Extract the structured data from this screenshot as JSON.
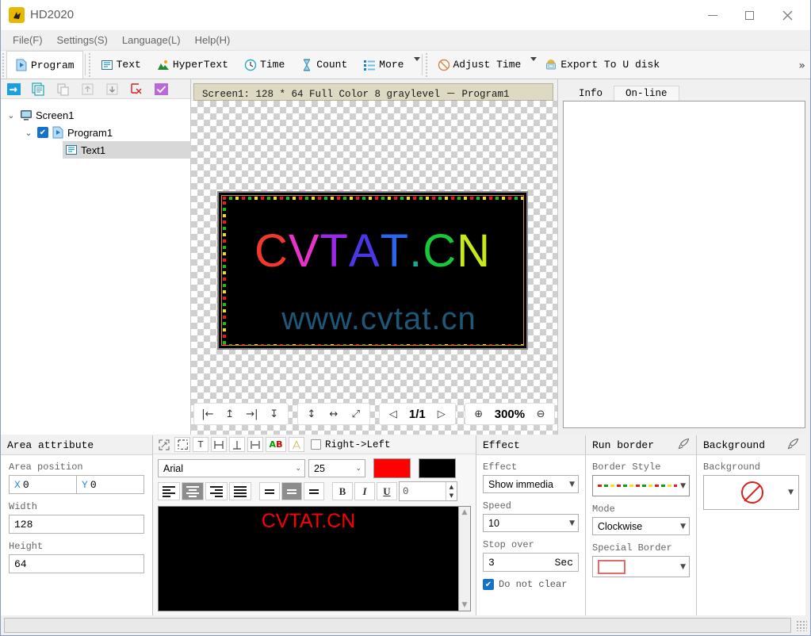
{
  "window": {
    "title": "HD2020",
    "logo_icon": "hd-logo-icon",
    "minimize": "—",
    "maximize": "□",
    "close": "✕"
  },
  "menubar": {
    "items": [
      {
        "label": "File(F)"
      },
      {
        "label": "Settings(S)"
      },
      {
        "label": "Language(L)"
      },
      {
        "label": "Help(H)"
      }
    ]
  },
  "ribbon": {
    "groups": [
      {
        "items": [
          {
            "label": "Program",
            "icon": "program-icon",
            "selected": true
          }
        ]
      },
      {
        "items": [
          {
            "label": "Text",
            "icon": "text-icon"
          },
          {
            "label": "HyperText",
            "icon": "hypertext-icon"
          },
          {
            "label": "Time",
            "icon": "clock-icon"
          },
          {
            "label": "Count",
            "icon": "hourglass-icon"
          },
          {
            "label": "More",
            "icon": "more-list-icon",
            "has_caret": true
          }
        ]
      },
      {
        "items": [
          {
            "label": "Adjust Time",
            "icon": "adjust-time-icon",
            "has_caret": true
          },
          {
            "label": "Export To U disk",
            "icon": "usb-export-icon"
          }
        ]
      }
    ],
    "overflow": "»"
  },
  "tree_panel": {
    "toolbar_icons": [
      "send-icon",
      "copy-program-icon",
      "paste-icon",
      "move-up-icon",
      "move-down-icon",
      "delete-icon",
      "confirm-icon"
    ],
    "nodes": [
      {
        "label": "Screen1",
        "icon": "monitor-icon",
        "twisty": "⌄",
        "indent": 0,
        "checked": false,
        "selected": false
      },
      {
        "label": "Program1",
        "icon": "program-play-icon",
        "twisty": "⌄",
        "indent": 1,
        "checked": true,
        "selected": false
      },
      {
        "label": "Text1",
        "icon": "text-area-icon",
        "twisty": "",
        "indent": 2,
        "checked": false,
        "selected": true
      }
    ]
  },
  "preview": {
    "screen_title": "Screen1: 128 * 64 Full Color 8 graylevel － Program1",
    "led": {
      "text": "CVTAT.CN",
      "letters": [
        {
          "ch": "C",
          "color": "#f0392b"
        },
        {
          "ch": "V",
          "color": "#e832c8"
        },
        {
          "ch": "T",
          "color": "#9a2ae8"
        },
        {
          "ch": "A",
          "color": "#4a38e8"
        },
        {
          "ch": "T",
          "color": "#2a66f0"
        },
        {
          "ch": ".",
          "color": "#18a89a"
        },
        {
          "ch": "C",
          "color": "#18c838"
        },
        {
          "ch": "N",
          "color": "#c8e818"
        }
      ],
      "watermark": "www.cvtat.cn",
      "watermark_color": "#1d5878",
      "border_colors": [
        "#e02020",
        "#16c016",
        "#f0e020"
      ]
    },
    "toolbar": {
      "align_left": "|←",
      "align_top": "↥",
      "align_right": "→|",
      "align_bottom": "↧",
      "stretch_vertical": "↕",
      "stretch_horizontal": "↔",
      "fit_all": "⤢",
      "page_prev": "◁",
      "page_label": "1/1",
      "page_next": "▷",
      "zoom_in": "⊕",
      "zoom_label": "300%",
      "zoom_out": "⊖"
    }
  },
  "right_panel": {
    "tabs": [
      {
        "label": "Info",
        "active": true
      },
      {
        "label": "On-line",
        "active": false
      }
    ],
    "content": ""
  },
  "area_attribute": {
    "title": "Area attribute",
    "position_label": "Area position",
    "x_label": "X",
    "x_value": "0",
    "y_label": "Y",
    "y_value": "0",
    "width_label": "Width",
    "width_value": "128",
    "height_label": "Height",
    "height_value": "64"
  },
  "text_panel": {
    "toolbar": [
      {
        "icon": "expand-area-icon",
        "label": ""
      },
      {
        "icon": "select-area-icon",
        "label": ""
      },
      {
        "icon": "text-tool-icon",
        "label": "T"
      },
      {
        "icon": "align-middle-h-icon",
        "label": "⊟"
      },
      {
        "icon": "align-bottom-icon",
        "label": "⊥"
      },
      {
        "icon": "align-center-icon",
        "label": "⊟"
      },
      {
        "icon": "colorful-text-icon",
        "label": "AB"
      },
      {
        "icon": "outline-text-icon",
        "label": "A"
      }
    ],
    "direction_checkbox": {
      "label": "Right->Left",
      "checked": false
    },
    "font_family": "Arial",
    "font_size": "25",
    "fg_color": "#ff0000",
    "bg_color": "#000000",
    "align_buttons": [
      {
        "icon": "align-left-icon",
        "active": false
      },
      {
        "icon": "align-center-icon",
        "active": true
      },
      {
        "icon": "align-right-icon",
        "active": false
      },
      {
        "icon": "align-justify-icon",
        "active": false
      }
    ],
    "valign_buttons": [
      {
        "icon": "valign-top-icon",
        "active": false
      },
      {
        "icon": "valign-middle-icon",
        "active": true
      },
      {
        "icon": "valign-bottom-icon",
        "active": false
      }
    ],
    "bold": "B",
    "italic": "I",
    "underline": "U",
    "spacing_value": "0",
    "editor_text": "CVTAT.CN",
    "editor_text_color": "#ff0000",
    "editor_bg": "#000000"
  },
  "effect_panel": {
    "title": "Effect",
    "effect_label": "Effect",
    "effect_value": "Show immedia",
    "speed_label": "Speed",
    "speed_value": "10",
    "stop_over_label": "Stop over",
    "stop_over_value": "3",
    "stop_over_unit": "Sec",
    "do_not_clear_label": "Do not clear",
    "do_not_clear_checked": true
  },
  "run_border_panel": {
    "title": "Run border",
    "border_style_label": "Border Style",
    "border_style_value": "dashed-multicolor",
    "mode_label": "Mode",
    "mode_value": "Clockwise",
    "special_border_label": "Special Border",
    "special_border_value": "red-rect"
  },
  "background_panel": {
    "title": "Background",
    "background_label": "Background",
    "background_value": "none"
  },
  "statusbar": {
    "text": ""
  }
}
